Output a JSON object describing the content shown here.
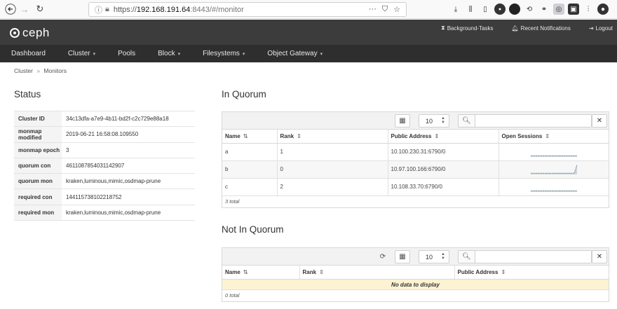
{
  "browser": {
    "url_scheme": "https://",
    "url_host": "192.168.191.64",
    "url_rest": ":8443/#/monitor",
    "url_menu": "···"
  },
  "app": {
    "logo_text": "ceph",
    "header_links": [
      "Background-Tasks",
      "Recent Notifications",
      "Logout"
    ]
  },
  "nav": [
    {
      "label": "Dashboard",
      "caret": false
    },
    {
      "label": "Cluster",
      "caret": true
    },
    {
      "label": "Pools",
      "caret": false
    },
    {
      "label": "Block",
      "caret": true
    },
    {
      "label": "Filesystems",
      "caret": true
    },
    {
      "label": "Object Gateway",
      "caret": true
    }
  ],
  "breadcrumb": {
    "parent": "Cluster",
    "sep": "»",
    "current": "Monitors"
  },
  "status": {
    "title": "Status",
    "rows": [
      {
        "key": "Cluster ID",
        "value": "34c13dfa-a7e9-4b11-bd2f-c2c729e88a18"
      },
      {
        "key": "monmap modified",
        "value": "2019-06-21 16:58:08.109550"
      },
      {
        "key": "monmap epoch",
        "value": "3"
      },
      {
        "key": "quorum con",
        "value": "4611087854031142907"
      },
      {
        "key": "quorum mon",
        "value": "kraken,luminous,mimic,osdmap-prune"
      },
      {
        "key": "required con",
        "value": "144115738102218752"
      },
      {
        "key": "required mon",
        "value": "kraken,luminous,mimic,osdmap-prune"
      }
    ]
  },
  "in_quorum": {
    "title": "In Quorum",
    "page_size": "10",
    "search_placeholder": "",
    "columns": [
      "Name",
      "Rank",
      "Public Address",
      "Open Sessions"
    ],
    "rows": [
      {
        "name": "a",
        "rank": "1",
        "address": "10.100.230.31:6790/0",
        "sessions": [
          1,
          1,
          1,
          1,
          1,
          1,
          1,
          1,
          1,
          1,
          1,
          1,
          1,
          1,
          1,
          1,
          1,
          1
        ]
      },
      {
        "name": "b",
        "rank": "0",
        "address": "10.97.100.166:6790/0",
        "sessions": [
          1,
          1,
          1,
          1,
          1,
          1,
          1,
          1,
          1,
          1,
          1,
          1,
          1,
          1,
          1,
          1,
          1,
          8
        ]
      },
      {
        "name": "c",
        "rank": "2",
        "address": "10.108.33.70:6790/0",
        "sessions": [
          1,
          1,
          1,
          1,
          1,
          1,
          1,
          1,
          1,
          1,
          1,
          1,
          1,
          1,
          1,
          1,
          1,
          1
        ]
      }
    ],
    "footer": "3 total"
  },
  "not_in_quorum": {
    "title": "Not In Quorum",
    "page_size": "10",
    "search_placeholder": "",
    "columns": [
      "Name",
      "Rank",
      "Public Address"
    ],
    "empty_text": "No data to display",
    "footer": "0 total"
  },
  "colors": {
    "header_bg": "#3c3c3c",
    "nav_bg": "#2e2e2e",
    "empty_row": "#fcf3d2"
  }
}
